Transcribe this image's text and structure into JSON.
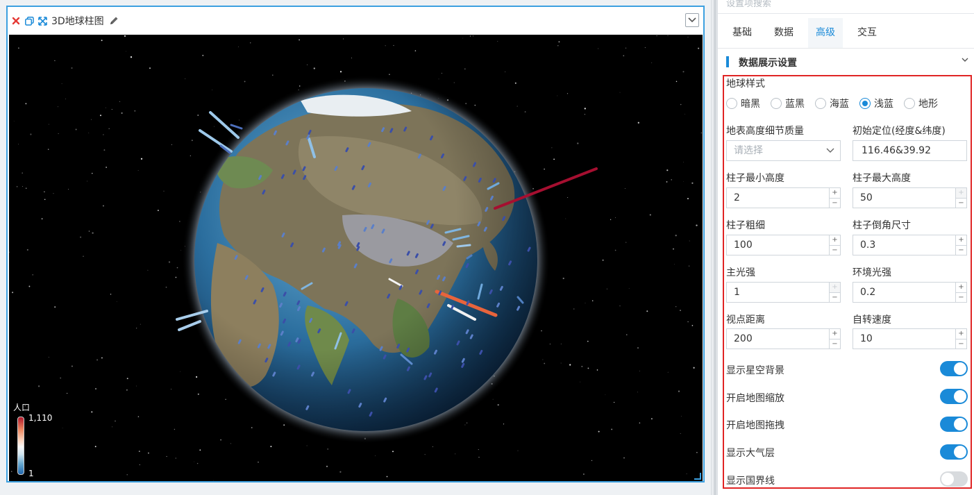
{
  "widget": {
    "title": "3D地球柱图",
    "legend": {
      "title": "人口",
      "max": "1,110",
      "min": "1"
    }
  },
  "panel": {
    "search_placeholder": "设置项搜索",
    "tabs": [
      "基础",
      "数据",
      "高级",
      "交互"
    ],
    "active_tab": "高级",
    "section_title": "数据展示设置",
    "globe_style": {
      "label": "地球样式",
      "options": [
        "暗黑",
        "蓝黑",
        "海蓝",
        "浅蓝",
        "地形"
      ],
      "selected": "浅蓝"
    },
    "terrain_quality": {
      "label": "地表高度细节质量",
      "placeholder": "请选择"
    },
    "initial_position": {
      "label": "初始定位(经度&纬度)",
      "value": "116.46&39.92"
    },
    "min_height": {
      "label": "柱子最小高度",
      "value": "2"
    },
    "max_height": {
      "label": "柱子最大高度",
      "value": "50"
    },
    "thickness": {
      "label": "柱子粗细",
      "value": "100"
    },
    "bevel": {
      "label": "柱子倒角尺寸",
      "value": "0.3"
    },
    "main_light": {
      "label": "主光强",
      "value": "1"
    },
    "ambient_light": {
      "label": "环境光强",
      "value": "0.2"
    },
    "view_distance": {
      "label": "视点距离",
      "value": "200"
    },
    "rotate_speed": {
      "label": "自转速度",
      "value": "10"
    },
    "toggles": [
      {
        "label": "显示星空背景",
        "on": true
      },
      {
        "label": "开启地图缩放",
        "on": true
      },
      {
        "label": "开启地图拖拽",
        "on": true
      },
      {
        "label": "显示大气层",
        "on": true
      },
      {
        "label": "显示国界线",
        "on": false
      }
    ]
  },
  "colors": {
    "accent": "#1a8ad8",
    "highlight_box": "#e02424",
    "widget_border": "#3ca0e0"
  }
}
